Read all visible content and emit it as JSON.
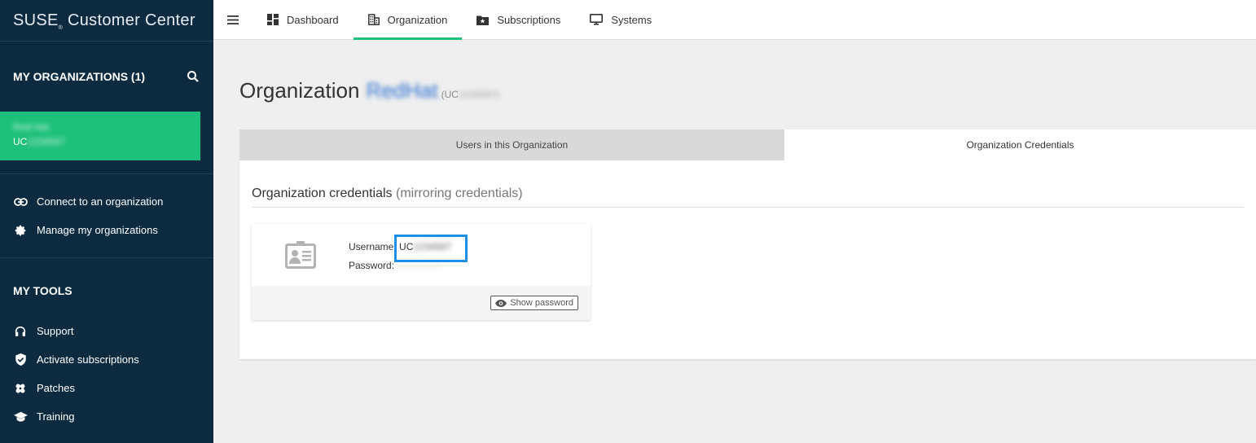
{
  "brand": {
    "title": "SUSE",
    "reg": "®",
    "subtitle": "Customer Center"
  },
  "sidebar": {
    "orgs_heading": "MY ORGANIZATIONS (1)",
    "org": {
      "name": "Red Hat",
      "id_prefix": "UC",
      "id_redacted": "1234567"
    },
    "links": [
      {
        "label": "Connect to an organization",
        "icon": "link-icon"
      },
      {
        "label": "Manage my organizations",
        "icon": "gear-icon"
      }
    ],
    "tools_heading": "MY TOOLS",
    "tools": [
      {
        "label": "Support",
        "icon": "headset-icon"
      },
      {
        "label": "Activate subscriptions",
        "icon": "shield-check-icon"
      },
      {
        "label": "Patches",
        "icon": "bandage-icon"
      },
      {
        "label": "Training",
        "icon": "graduation-cap-icon"
      }
    ]
  },
  "topnav": {
    "tabs": [
      {
        "label": "Dashboard",
        "icon": "dashboard-icon"
      },
      {
        "label": "Organization",
        "icon": "building-icon",
        "active": true
      },
      {
        "label": "Subscriptions",
        "icon": "folder-star-icon"
      },
      {
        "label": "Systems",
        "icon": "monitor-icon"
      }
    ]
  },
  "main": {
    "title": "Organization",
    "org_name_redacted": "RedHat",
    "org_id_prefix": "(UC",
    "org_id_redacted": "1234567)",
    "tabs": [
      {
        "label": "Users in this Organization"
      },
      {
        "label": "Organization Credentials",
        "active": true
      }
    ],
    "panel_title": "Organization credentials",
    "panel_title_muted": "(mirroring credentials)",
    "username_label": "Username:",
    "username_prefix": "UC",
    "username_redacted": "1234567",
    "password_label": "Password:",
    "password_mask": "··············",
    "show_password": "Show password"
  },
  "colors": {
    "sidebar": "#0c2b40",
    "accent": "#1dc07a",
    "highlight": "#1e8fe6"
  }
}
